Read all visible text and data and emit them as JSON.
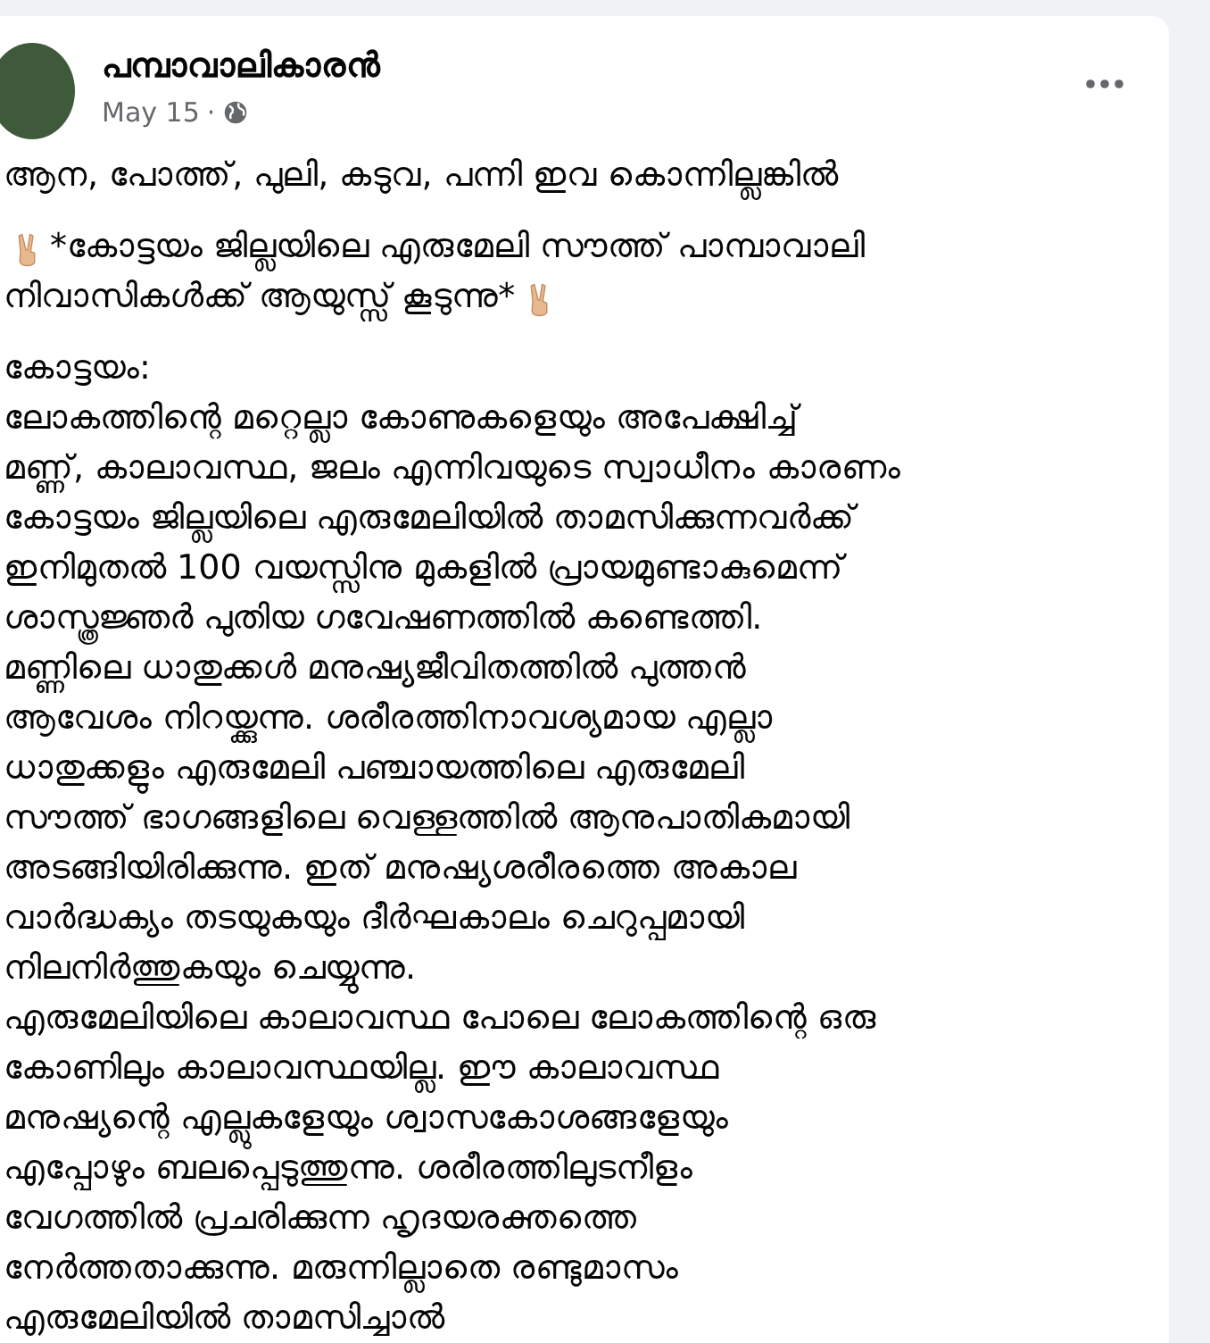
{
  "post": {
    "author": "പമ്പാവാലികാരൻ",
    "date": "May 15",
    "separator": "·",
    "paragraphs": [
      {
        "lines": [
          {
            "text": "ആന, പോത്ത്, പുലി, കടുവ, പന്നി ഇവ കൊന്നില്ലങ്കിൽ"
          }
        ]
      },
      {
        "lines": [
          {
            "text": "*കോട്ടയം ജില്ലയിലെ എരുമേലി സൗത്ത് പാമ്പാവാലി",
            "lead_emoji": true
          },
          {
            "text": "നിവാസികൾക്ക്  ആയുസ്സ് കൂടുന്നു*",
            "trail_emoji": true
          }
        ]
      },
      {
        "lines": [
          {
            "text": "കോട്ടയം:"
          },
          {
            "text": "ലോകത്തിന്റെ മറ്റെല്ലാ കോണുകളെയും അപേക്ഷിച്ച്"
          },
          {
            "text": "മണ്ണ്, കാലാവസ്ഥ, ജലം എന്നിവയുടെ സ്വാധീനം കാരണം"
          },
          {
            "text": "കോട്ടയം ജില്ലയിലെ  എരുമേലിയിൽ താമസിക്കുന്നവർക്ക്"
          },
          {
            "text": "ഇനിമുതൽ 100 വയസ്സിനു മുകളിൽ പ്രായമുണ്ടാകുമെന്ന്"
          },
          {
            "text": "ശാസ്ത്രജ്ഞർ പുതിയ ഗവേഷണത്തിൽ കണ്ടെത്തി."
          },
          {
            "text": "മണ്ണിലെ ധാതുക്കൾ മനുഷ്യജീവിതത്തിൽ പുത്തൻ"
          },
          {
            "text": "ആവേശം നിറയ്ക്കുന്നു. ശരീരത്തിനാവശ്യമായ എല്ലാ"
          },
          {
            "text": "ധാതുക്കളും എരുമേലി പഞ്ചായത്തിലെ എരുമേലി"
          },
          {
            "text": "സൗത്ത്  ഭാഗങ്ങളിലെ വെള്ളത്തിൽ ആനുപാതികമായി"
          },
          {
            "text": "അടങ്ങിയിരിക്കുന്നു. ഇത് മനുഷ്യശരീരത്തെ അകാല"
          },
          {
            "text": "വാർദ്ധക്യം തടയുകയും ദീർഘകാലം ചെറുപ്പമായി"
          },
          {
            "text": "നിലനിർത്തുകയും ചെയ്യുന്നു."
          },
          {
            "text": "എരുമേലിയിലെ കാലാവസ്ഥ പോലെ ലോകത്തിന്റെ ഒരു"
          },
          {
            "text": "കോണിലും കാലാവസ്ഥയില്ല. ഈ കാലാവസ്ഥ"
          },
          {
            "text": "മനുഷ്യന്റെ എല്ലുകളേയും ശ്വാസകോശങ്ങളേയും"
          },
          {
            "text": "എപ്പോഴും ബലപ്പെടുത്തുന്നു. ശരീരത്തിലുടനീളം"
          },
          {
            "text": "വേഗത്തിൽ പ്രചരിക്കുന്ന ഹൃദയരക്തത്തെ"
          },
          {
            "text": "നേർത്തതാക്കുന്നു. മരുന്നില്ലാതെ രണ്ടുമാസം"
          },
          {
            "text": "എരുമേലിയിൽ താമസിച്ചാൽ"
          }
        ]
      }
    ]
  }
}
